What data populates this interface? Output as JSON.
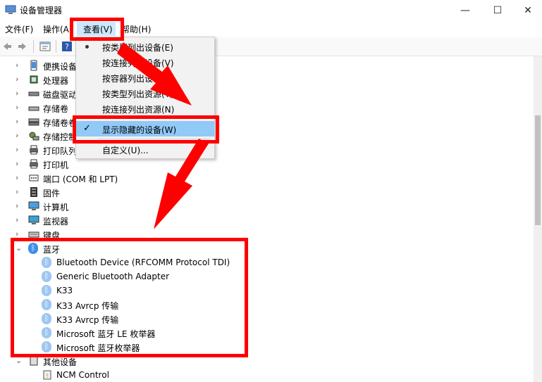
{
  "window": {
    "title": "设备管理器",
    "min_glyph": "—",
    "max_glyph": "☐",
    "close_glyph": "✕"
  },
  "menu": {
    "file": "文件(F)",
    "action": "操作(A)",
    "view": "查看(V)",
    "help": "帮助(H)"
  },
  "view_menu": {
    "items": [
      {
        "label": "按类型列出设备(E)",
        "marker": "bullet"
      },
      {
        "label": "按连接列出设备(V)",
        "marker": ""
      },
      {
        "label": "按容器列出设备",
        "marker": ""
      },
      {
        "label": "按类型列出资源(Y)",
        "marker": ""
      },
      {
        "label": "按连接列出资源(N)",
        "marker": ""
      },
      {
        "label": "显示隐藏的设备(W)",
        "marker": "check"
      },
      {
        "label": "自定义(U)...",
        "marker": ""
      }
    ]
  },
  "tree": {
    "categories": [
      {
        "label": "便携设备",
        "icon": "portable-device-icon"
      },
      {
        "label": "处理器",
        "icon": "processor-icon"
      },
      {
        "label": "磁盘驱动器",
        "icon": "disk-drive-icon"
      },
      {
        "label": "存储卷",
        "icon": "storage-volume-icon"
      },
      {
        "label": "存储卷卷影副本",
        "icon": "storage-volume-shadow-icon"
      },
      {
        "label": "存储控制器",
        "icon": "storage-controller-icon"
      },
      {
        "label": "打印队列",
        "icon": "print-queue-icon"
      },
      {
        "label": "打印机",
        "icon": "printer-icon"
      },
      {
        "label": "端口 (COM 和 LPT)",
        "icon": "port-icon"
      },
      {
        "label": "固件",
        "icon": "firmware-icon"
      },
      {
        "label": "计算机",
        "icon": "computer-icon"
      },
      {
        "label": "监视器",
        "icon": "monitor-icon"
      },
      {
        "label": "键盘",
        "icon": "keyboard-icon"
      }
    ],
    "bluetooth": {
      "label": "蓝牙",
      "children": [
        {
          "label": "Bluetooth Device (RFCOMM Protocol TDI)",
          "hidden": true
        },
        {
          "label": "Generic Bluetooth Adapter",
          "hidden": true
        },
        {
          "label": "K33",
          "hidden": true
        },
        {
          "label": "K33 Avrcp 传输",
          "hidden": true
        },
        {
          "label": "K33 Avrcp 传输",
          "hidden": true
        },
        {
          "label": "Microsoft 蓝牙 LE 枚举器",
          "hidden": true
        },
        {
          "label": "Microsoft 蓝牙枚举器",
          "hidden": true
        }
      ]
    },
    "other": {
      "label": "其他设备",
      "children": [
        {
          "label": "NCM Control"
        }
      ]
    }
  },
  "colors": {
    "annotation_red": "#ff0000",
    "menu_highlight": "#cce8ff",
    "bluetooth_blue": "#3d8fe6"
  }
}
